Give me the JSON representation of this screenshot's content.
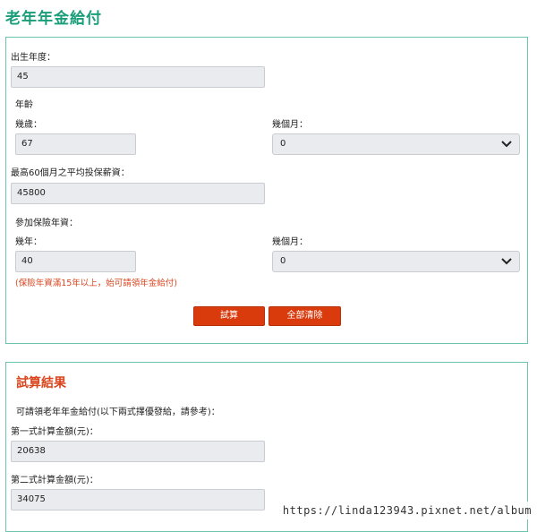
{
  "page": {
    "title": "老年年金給付"
  },
  "form": {
    "birth_year_label": "出生年度：",
    "birth_year_value": "45",
    "age_section_label": "年齡",
    "age_years_label": "幾歲：",
    "age_years_value": "67",
    "age_months_label": "幾個月：",
    "age_months_selected": "0",
    "avg_salary_label": "最高60個月之平均投保薪資：",
    "avg_salary_value": "45800",
    "insured_section_label": "參加保險年資：",
    "insured_years_label": "幾年：",
    "insured_years_value": "40",
    "insured_months_label": "幾個月：",
    "insured_months_selected": "0",
    "note": "(保險年資滿15年以上，始可請領年金給付)",
    "calc_button": "試算",
    "clear_button": "全部清除"
  },
  "result": {
    "title": "試算結果",
    "description": "可請領老年年金給付(以下兩式擇優發給，請參考)：",
    "formula1_label": "第一式計算金額(元)：",
    "formula1_value": "20638",
    "formula2_label": "第二式計算金額(元)：",
    "formula2_value": "34075"
  },
  "watermark": "https://linda123943.pixnet.net/album",
  "colors": {
    "title_green": "#1a9e7a",
    "panel_border": "#6cc3ae",
    "accent_red": "#d93b0d"
  }
}
